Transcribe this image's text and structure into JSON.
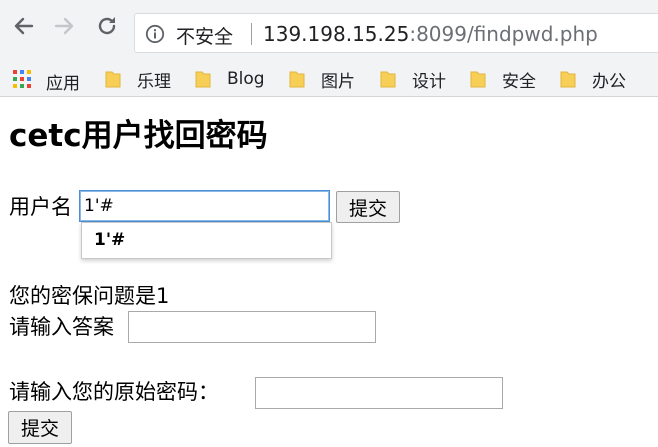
{
  "browser": {
    "security_label": "不安全",
    "url_host": "139.198.15.25",
    "url_rest": ":8099/findpwd.php",
    "bookmarks": {
      "apps_label": "应用",
      "items": [
        {
          "label": "乐理"
        },
        {
          "label": "Blog"
        },
        {
          "label": "图片"
        },
        {
          "label": "设计"
        },
        {
          "label": "安全"
        },
        {
          "label": "办公"
        }
      ]
    }
  },
  "page": {
    "title": "cetc用户找回密码",
    "username_label": "用户名",
    "username_value": "1'#",
    "submit_label": "提交",
    "autocomplete_suggestion": "1'#",
    "security_question": "您的密保问题是1",
    "answer_label": "请输入答案",
    "answer_value": "",
    "original_password_label": "请输入您的原始密码：",
    "original_password_value": "",
    "submit2_label": "提交"
  },
  "colors": {
    "chrome_bg": "#f1f3f4",
    "folder_yellow": "#f7cf57",
    "focus_border": "#4a90d9"
  }
}
